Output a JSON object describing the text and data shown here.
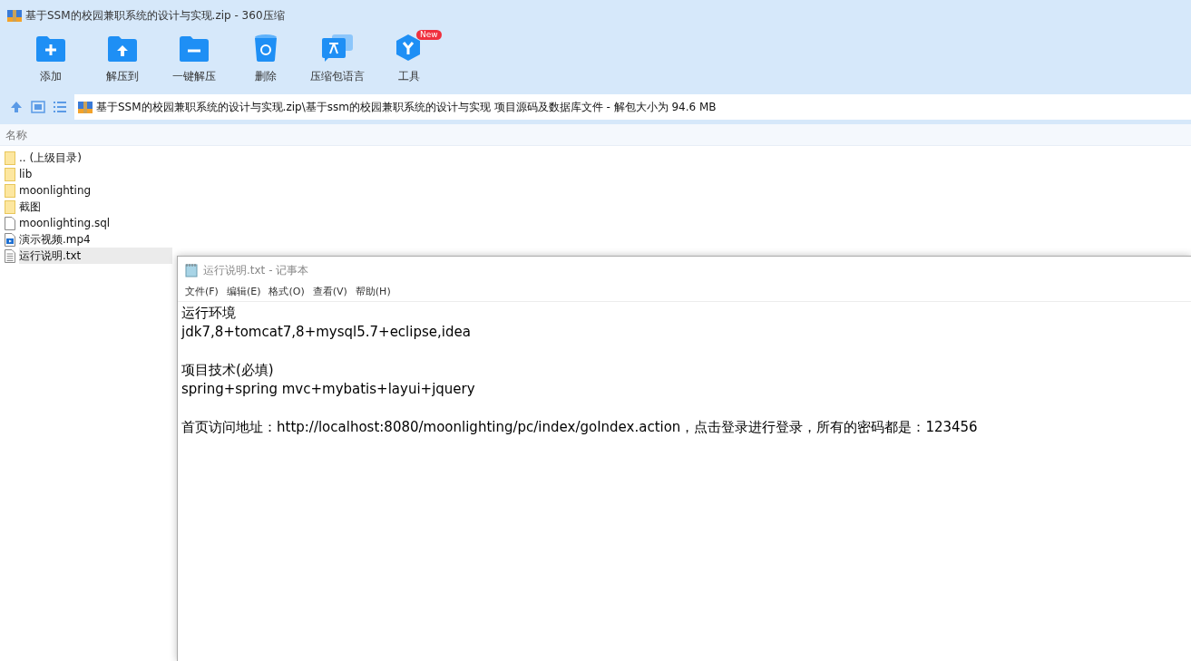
{
  "window": {
    "title": "基于SSM的校园兼职系统的设计与实现.zip - 360压缩"
  },
  "toolbar": [
    {
      "label": "添加",
      "kind": "add"
    },
    {
      "label": "解压到",
      "kind": "extract"
    },
    {
      "label": "一键解压",
      "kind": "quick"
    },
    {
      "label": "删除",
      "kind": "delete"
    },
    {
      "label": "压缩包语言",
      "kind": "language"
    },
    {
      "label": "工具",
      "kind": "tools",
      "badge": "New"
    }
  ],
  "address_bar": {
    "path": "基于SSM的校园兼职系统的设计与实现.zip\\基于ssm的校园兼职系统的设计与实现 项目源码及数据库文件 - 解包大小为 94.6 MB"
  },
  "file_list": {
    "columns": [
      "名称"
    ],
    "rows": [
      {
        "name": ".. (上级目录)",
        "kind": "folder",
        "selected": false
      },
      {
        "name": "lib",
        "kind": "folder",
        "selected": false
      },
      {
        "name": "moonlighting",
        "kind": "folder",
        "selected": false
      },
      {
        "name": "截图",
        "kind": "folder",
        "selected": false
      },
      {
        "name": "moonlighting.sql",
        "kind": "file",
        "selected": false
      },
      {
        "name": "演示视频.mp4",
        "kind": "video",
        "selected": false
      },
      {
        "name": "运行说明.txt",
        "kind": "text",
        "selected": true
      }
    ]
  },
  "notepad": {
    "title": "运行说明.txt - 记事本",
    "menu": [
      "文件(F)",
      "编辑(E)",
      "格式(O)",
      "查看(V)",
      "帮助(H)"
    ],
    "paragraphs": [
      [
        "运行环境",
        "jdk7,8+tomcat7,8+mysql5.7+eclipse,idea"
      ],
      [
        "项目技术(必填)",
        "spring+spring mvc+mybatis+layui+jquery"
      ],
      [
        "首页访问地址：http://localhost:8080/moonlighting/pc/index/goIndex.action，点击登录进行登录，所有的密码都是：123456"
      ]
    ]
  }
}
